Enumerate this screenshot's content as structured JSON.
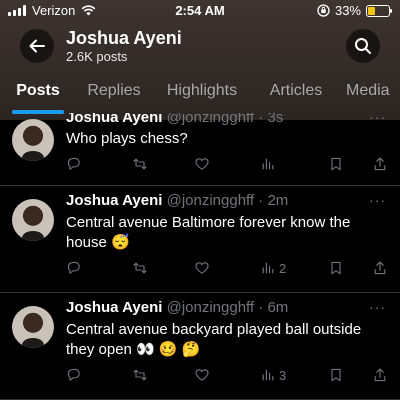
{
  "status_bar": {
    "carrier": "Verizon",
    "time": "2:54 AM",
    "battery": "33%",
    "battery_level": 0.33,
    "battery_color": "#f5c518"
  },
  "profile": {
    "name": "Joshua Ayeni",
    "posts": "2.6K posts"
  },
  "tabs": [
    {
      "label": "Posts",
      "active": true
    },
    {
      "label": "Replies",
      "active": false
    },
    {
      "label": "Highlights",
      "active": false
    },
    {
      "label": "Articles",
      "active": false
    },
    {
      "label": "Media",
      "active": false
    }
  ],
  "tweets": [
    {
      "name": "Joshua Ayeni",
      "handle": "@jonzingghff",
      "time": "· 3s",
      "more": "···",
      "text": "Who plays chess?",
      "views": ""
    },
    {
      "name": "Joshua Ayeni",
      "handle": "@jonzingghff",
      "time": "· 2m",
      "more": "···",
      "text": "Central avenue Baltimore forever know the house 😴",
      "views": "2"
    },
    {
      "name": "Joshua Ayeni",
      "handle": "@jonzingghff",
      "time": "· 6m",
      "more": "···",
      "text": "Central avenue backyard played ball outside they open 👀 🥴 🤔",
      "views": "3"
    }
  ],
  "icons": {
    "back": "arrow-left-icon",
    "search": "search-icon",
    "reply": "reply-icon",
    "repost": "repost-icon",
    "like": "like-icon",
    "views": "views-icon",
    "bookmark": "bookmark-icon",
    "share": "share-icon"
  },
  "colors": {
    "accent": "#1d9bf0",
    "header": "#3e3430",
    "muted": "#71767b"
  }
}
